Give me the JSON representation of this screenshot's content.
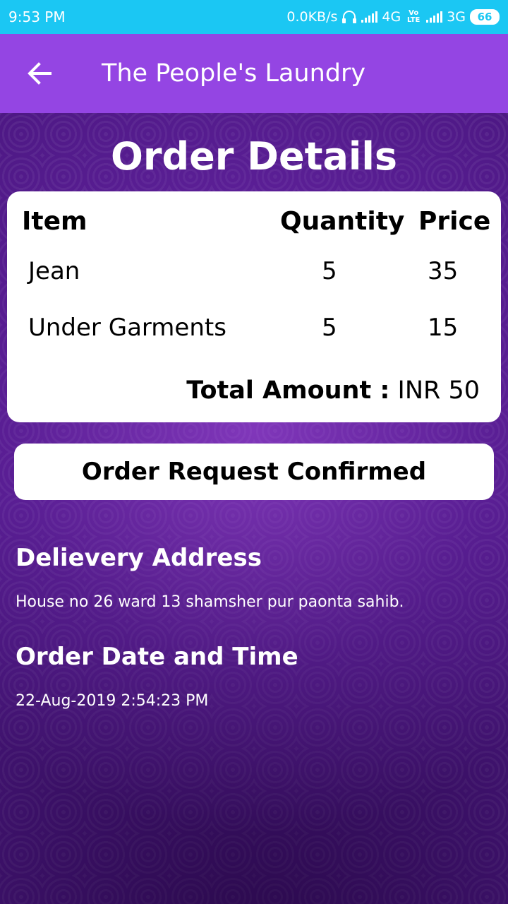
{
  "status": {
    "time": "9:53 PM",
    "speed": "0.0KB/s",
    "net1": "4G",
    "volte": "Vo LTE",
    "net2": "3G",
    "battery": "66"
  },
  "appbar": {
    "title": "The People's Laundry",
    "back_icon": "arrow-back-icon"
  },
  "page": {
    "title": "Order Details"
  },
  "table": {
    "headers": {
      "item": "Item",
      "quantity": "Quantity",
      "price": "Price"
    },
    "rows": [
      {
        "item": "Jean",
        "quantity": "5",
        "price": "35"
      },
      {
        "item": "Under Garments",
        "quantity": "5",
        "price": "15"
      }
    ],
    "total_label": "Total Amount :",
    "total_value": "INR 50"
  },
  "status_button": "Order Request Confirmed",
  "address": {
    "heading": "Delievery Address",
    "value": "House no 26 ward 13 shamsher pur paonta sahib."
  },
  "order_time": {
    "heading": "Order Date and Time",
    "value": "22-Aug-2019 2:54:23 PM"
  },
  "colors": {
    "status_bar": "#1bc7f3",
    "app_bar": "#9445e3",
    "background": "#4d1884"
  }
}
